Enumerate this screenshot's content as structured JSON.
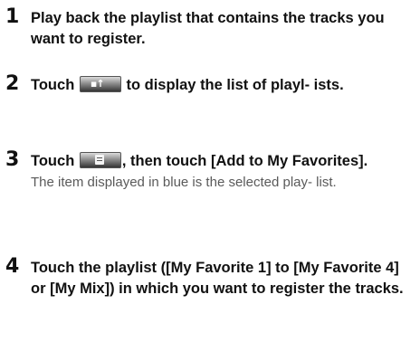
{
  "steps": [
    {
      "number": "1",
      "text": "Play back the playlist that contains the tracks you want to register."
    },
    {
      "number": "2",
      "text_before": "Touch",
      "button_icon": "playlist-list-button-icon",
      "text_after": "to display the list of playl- ists."
    },
    {
      "number": "3",
      "text_before": "Touch",
      "button_icon": "menu-button-icon",
      "text_after": ", then touch [Add to My Favorites].",
      "note": "The item displayed in blue is the selected play- list."
    },
    {
      "number": "4",
      "text": "Touch the playlist ([My Favorite 1] to [My Favorite 4] or [My Mix]) in which you want to register the tracks."
    }
  ]
}
